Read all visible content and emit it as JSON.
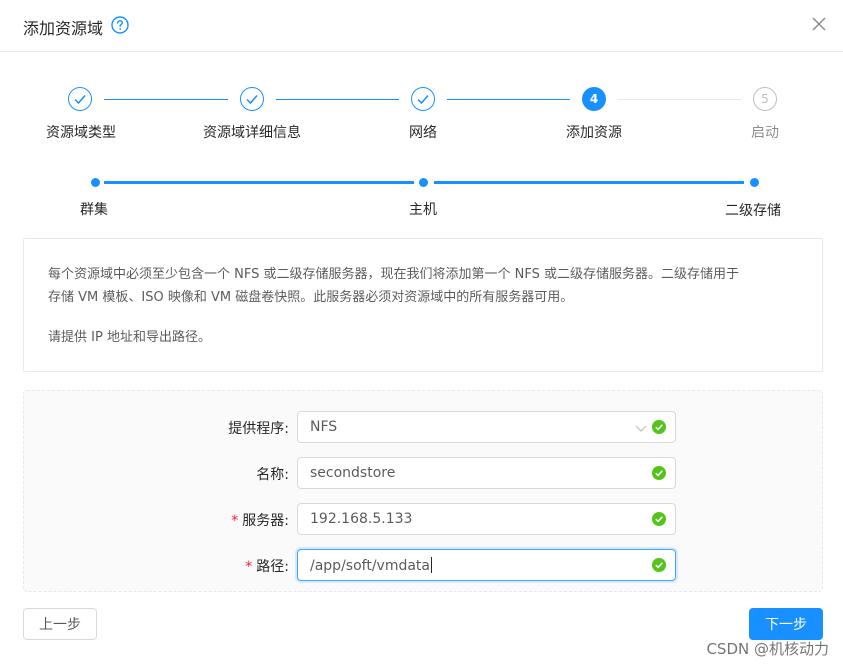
{
  "dialog": {
    "title": "添加资源域",
    "help_icon": "question-circle-icon",
    "close_icon": "close-icon"
  },
  "steps": [
    {
      "label": "资源域类型",
      "status": "done"
    },
    {
      "label": "资源域详细信息",
      "status": "done"
    },
    {
      "label": "网络",
      "status": "done"
    },
    {
      "label": "添加资源",
      "status": "active",
      "number": "4"
    },
    {
      "label": "启动",
      "status": "wait",
      "number": "5"
    }
  ],
  "substeps": [
    {
      "label": "群集"
    },
    {
      "label": "主机"
    },
    {
      "label": "二级存储"
    }
  ],
  "info": {
    "line1": "每个资源域中必须至少包含一个 NFS 或二级存储服务器，现在我们将添加第一个 NFS 或二级存储服务器。二级存储用于",
    "line2": "存储 VM 模板、ISO 映像和 VM 磁盘卷快照。此服务器必须对资源域中的所有服务器可用。",
    "line3": "请提供 IP 地址和导出路径。"
  },
  "form": {
    "provider": {
      "label": "提供程序:",
      "value": "NFS",
      "required": false
    },
    "name": {
      "label": "名称:",
      "value": "secondstore",
      "required": false
    },
    "server": {
      "label": "服务器:",
      "value": "192.168.5.133",
      "required": true
    },
    "path": {
      "label": "路径:",
      "value": "/app/soft/vmdata",
      "required": true
    },
    "required_mark": "*"
  },
  "buttons": {
    "prev": "上一步",
    "next": "下一步"
  },
  "watermark": "CSDN @机核动力",
  "colors": {
    "primary": "#1890ff",
    "success": "#52c41a",
    "required": "#f5222d"
  }
}
